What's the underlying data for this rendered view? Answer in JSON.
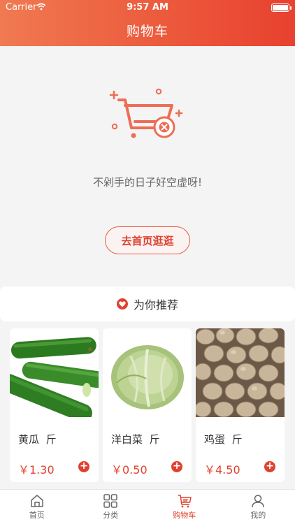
{
  "status": {
    "carrier": "Carrier",
    "time": "9:57 AM"
  },
  "header": {
    "title": "购物车"
  },
  "empty_cart": {
    "message": "不剁手的日子好空虚呀!",
    "button_label": "去首页逛逛"
  },
  "recommend": {
    "title": "为你推荐"
  },
  "products": [
    {
      "name": "黄瓜",
      "unit": "斤",
      "price": "￥1.30"
    },
    {
      "name": "洋白菜",
      "unit": "斤",
      "price": "￥0.50"
    },
    {
      "name": "鸡蛋",
      "unit": "斤",
      "price": "￥4.50"
    }
  ],
  "tabs": [
    {
      "label": "首页",
      "icon": "home-icon"
    },
    {
      "label": "分类",
      "icon": "category-grid-icon"
    },
    {
      "label": "购物车",
      "icon": "cart-icon",
      "active": true
    },
    {
      "label": "我的",
      "icon": "user-icon"
    }
  ],
  "colors": {
    "accent": "#e0412f",
    "header_start": "#f07a52",
    "header_end": "#e8412f"
  }
}
